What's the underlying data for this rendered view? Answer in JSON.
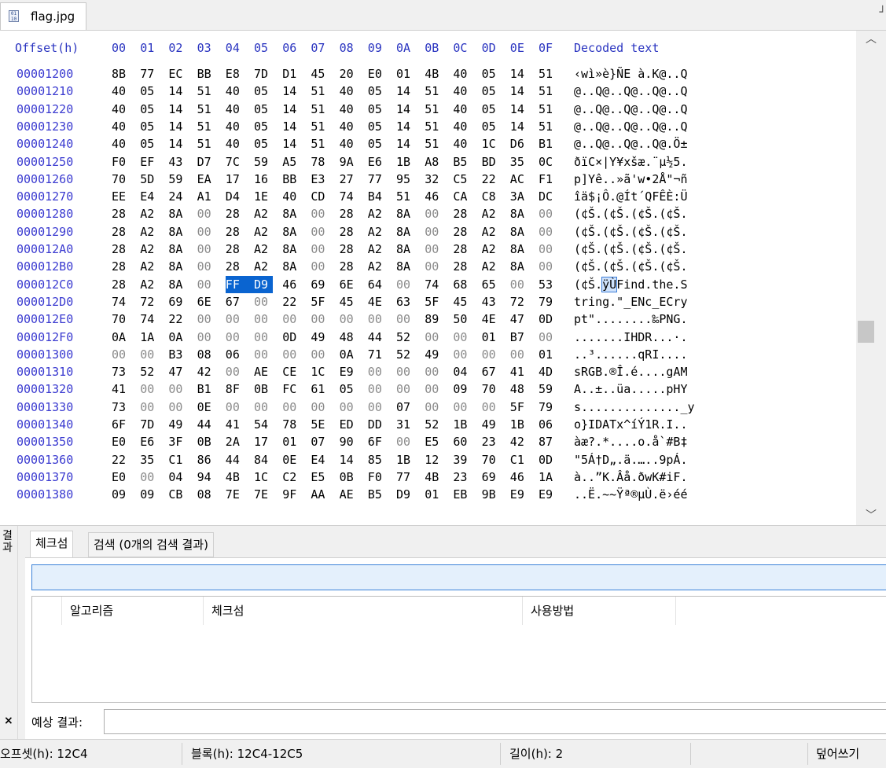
{
  "tab": {
    "file_name": "flag.jpg",
    "icon": "file-icon"
  },
  "hex": {
    "header_offset": "Offset(h)",
    "header_columns": [
      "00",
      "01",
      "02",
      "03",
      "04",
      "05",
      "06",
      "07",
      "08",
      "09",
      "0A",
      "0B",
      "0C",
      "0D",
      "0E",
      "0F"
    ],
    "header_decoded": "Decoded text",
    "rows": [
      {
        "offset": "00001200",
        "bytes": [
          "8B",
          "77",
          "EC",
          "BB",
          "E8",
          "7D",
          "D1",
          "45",
          "20",
          "E0",
          "01",
          "4B",
          "40",
          "05",
          "14",
          "51"
        ],
        "text": "‹wì»è}ÑE à.K@..Q"
      },
      {
        "offset": "00001210",
        "bytes": [
          "40",
          "05",
          "14",
          "51",
          "40",
          "05",
          "14",
          "51",
          "40",
          "05",
          "14",
          "51",
          "40",
          "05",
          "14",
          "51"
        ],
        "text": "@..Q@..Q@..Q@..Q"
      },
      {
        "offset": "00001220",
        "bytes": [
          "40",
          "05",
          "14",
          "51",
          "40",
          "05",
          "14",
          "51",
          "40",
          "05",
          "14",
          "51",
          "40",
          "05",
          "14",
          "51"
        ],
        "text": "@..Q@..Q@..Q@..Q"
      },
      {
        "offset": "00001230",
        "bytes": [
          "40",
          "05",
          "14",
          "51",
          "40",
          "05",
          "14",
          "51",
          "40",
          "05",
          "14",
          "51",
          "40",
          "05",
          "14",
          "51"
        ],
        "text": "@..Q@..Q@..Q@..Q"
      },
      {
        "offset": "00001240",
        "bytes": [
          "40",
          "05",
          "14",
          "51",
          "40",
          "05",
          "14",
          "51",
          "40",
          "05",
          "14",
          "51",
          "40",
          "1C",
          "D6",
          "B1"
        ],
        "text": "@..Q@..Q@..Q@.Ö±"
      },
      {
        "offset": "00001250",
        "bytes": [
          "F0",
          "EF",
          "43",
          "D7",
          "7C",
          "59",
          "A5",
          "78",
          "9A",
          "E6",
          "1B",
          "A8",
          "B5",
          "BD",
          "35",
          "0C"
        ],
        "text": "ðïC×|Y¥xšæ.¨µ½5."
      },
      {
        "offset": "00001260",
        "bytes": [
          "70",
          "5D",
          "59",
          "EA",
          "17",
          "16",
          "BB",
          "E3",
          "27",
          "77",
          "95",
          "32",
          "C5",
          "22",
          "AC",
          "F1"
        ],
        "text": "p]Yê..»ã'w•2Å\"¬ñ"
      },
      {
        "offset": "00001270",
        "bytes": [
          "EE",
          "E4",
          "24",
          "A1",
          "D4",
          "1E",
          "40",
          "CD",
          "74",
          "B4",
          "51",
          "46",
          "CA",
          "C8",
          "3A",
          "DC"
        ],
        "text": "îä$¡Ô.@Ít´QFÊÈ:Ü"
      },
      {
        "offset": "00001280",
        "bytes": [
          "28",
          "A2",
          "8A",
          "00",
          "28",
          "A2",
          "8A",
          "00",
          "28",
          "A2",
          "8A",
          "00",
          "28",
          "A2",
          "8A",
          "00"
        ],
        "text": "(¢Š.(¢Š.(¢Š.(¢Š."
      },
      {
        "offset": "00001290",
        "bytes": [
          "28",
          "A2",
          "8A",
          "00",
          "28",
          "A2",
          "8A",
          "00",
          "28",
          "A2",
          "8A",
          "00",
          "28",
          "A2",
          "8A",
          "00"
        ],
        "text": "(¢Š.(¢Š.(¢Š.(¢Š."
      },
      {
        "offset": "000012A0",
        "bytes": [
          "28",
          "A2",
          "8A",
          "00",
          "28",
          "A2",
          "8A",
          "00",
          "28",
          "A2",
          "8A",
          "00",
          "28",
          "A2",
          "8A",
          "00"
        ],
        "text": "(¢Š.(¢Š.(¢Š.(¢Š."
      },
      {
        "offset": "000012B0",
        "bytes": [
          "28",
          "A2",
          "8A",
          "00",
          "28",
          "A2",
          "8A",
          "00",
          "28",
          "A2",
          "8A",
          "00",
          "28",
          "A2",
          "8A",
          "00"
        ],
        "text": "(¢Š.(¢Š.(¢Š.(¢Š."
      },
      {
        "offset": "000012C0",
        "bytes": [
          "28",
          "A2",
          "8A",
          "00",
          "FF",
          "D9",
          "46",
          "69",
          "6E",
          "64",
          "00",
          "74",
          "68",
          "65",
          "00",
          "53"
        ],
        "text": "(¢Š.ÿÙFind.the.S"
      },
      {
        "offset": "000012D0",
        "bytes": [
          "74",
          "72",
          "69",
          "6E",
          "67",
          "00",
          "22",
          "5F",
          "45",
          "4E",
          "63",
          "5F",
          "45",
          "43",
          "72",
          "79"
        ],
        "text": "tring.\"_ENc_ECry"
      },
      {
        "offset": "000012E0",
        "bytes": [
          "70",
          "74",
          "22",
          "00",
          "00",
          "00",
          "00",
          "00",
          "00",
          "00",
          "00",
          "89",
          "50",
          "4E",
          "47",
          "0D"
        ],
        "text": "pt\"........‰PNG."
      },
      {
        "offset": "000012F0",
        "bytes": [
          "0A",
          "1A",
          "0A",
          "00",
          "00",
          "00",
          "0D",
          "49",
          "48",
          "44",
          "52",
          "00",
          "00",
          "01",
          "B7",
          "00"
        ],
        "text": ".......IHDR...·."
      },
      {
        "offset": "00001300",
        "bytes": [
          "00",
          "00",
          "B3",
          "08",
          "06",
          "00",
          "00",
          "00",
          "0A",
          "71",
          "52",
          "49",
          "00",
          "00",
          "00",
          "01"
        ],
        "text": "..³......qRI...."
      },
      {
        "offset": "00001310",
        "bytes": [
          "73",
          "52",
          "47",
          "42",
          "00",
          "AE",
          "CE",
          "1C",
          "E9",
          "00",
          "00",
          "00",
          "04",
          "67",
          "41",
          "4D"
        ],
        "text": "sRGB.®Î.é....gAM"
      },
      {
        "offset": "00001320",
        "bytes": [
          "41",
          "00",
          "00",
          "B1",
          "8F",
          "0B",
          "FC",
          "61",
          "05",
          "00",
          "00",
          "00",
          "09",
          "70",
          "48",
          "59"
        ],
        "text": "A..±..üa.....pHY"
      },
      {
        "offset": "00001330",
        "bytes": [
          "73",
          "00",
          "00",
          "0E",
          "00",
          "00",
          "00",
          "00",
          "00",
          "00",
          "07",
          "00",
          "00",
          "00",
          "5F",
          "79"
        ],
        "text": "s.............._y"
      },
      {
        "offset": "00001340",
        "bytes": [
          "6F",
          "7D",
          "49",
          "44",
          "41",
          "54",
          "78",
          "5E",
          "ED",
          "DD",
          "31",
          "52",
          "1B",
          "49",
          "1B",
          "06"
        ],
        "text": "o}IDATx^íÝ1R.I.."
      },
      {
        "offset": "00001350",
        "bytes": [
          "E0",
          "E6",
          "3F",
          "0B",
          "2A",
          "17",
          "01",
          "07",
          "90",
          "6F",
          "00",
          "E5",
          "60",
          "23",
          "42",
          "87"
        ],
        "text": "àæ?.*....o.å`#B‡"
      },
      {
        "offset": "00001360",
        "bytes": [
          "22",
          "35",
          "C1",
          "86",
          "44",
          "84",
          "0E",
          "E4",
          "14",
          "85",
          "1B",
          "12",
          "39",
          "70",
          "C1",
          "0D"
        ],
        "text": "\"5Á†D„.ä.…..9pÁ."
      },
      {
        "offset": "00001370",
        "bytes": [
          "E0",
          "00",
          "04",
          "94",
          "4B",
          "1C",
          "C2",
          "E5",
          "0B",
          "F0",
          "77",
          "4B",
          "23",
          "69",
          "46",
          "1A"
        ],
        "text": "à..”K.Âå.ðwK#iF."
      },
      {
        "offset": "00001380",
        "bytes": [
          "09",
          "09",
          "CB",
          "08",
          "7E",
          "7E",
          "9F",
          "AA",
          "AE",
          "B5",
          "D9",
          "01",
          "EB",
          "9B",
          "E9",
          "E9"
        ],
        "text": "..Ë.~~Ÿª®µÙ.ë›éé"
      }
    ],
    "selected_row": 12,
    "selected_bytes": [
      4,
      5
    ]
  },
  "results": {
    "side_title": "결과",
    "close_icon": "×",
    "tabs": [
      "체크섬",
      "검색 (0개의 검색 결과)"
    ],
    "columns": [
      "",
      "알고리즘",
      "체크섬",
      "사용방법"
    ],
    "expected_label": "예상 결과:"
  },
  "status": {
    "offset": "오프셋(h): 12C4",
    "block": "블록(h): 12C4-12C5",
    "length": "길이(h): 2",
    "mode": "덮어쓰기"
  },
  "colors": {
    "selection": "#0a64d0",
    "offset_text": "#3a3ad0",
    "header_text": "#2a34c0"
  }
}
